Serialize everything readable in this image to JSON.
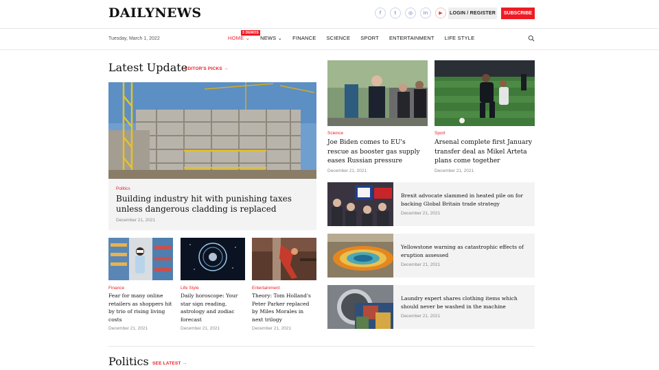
{
  "site": {
    "logo": "DAILYNEWS",
    "date": "Tuesday, March 1, 2022",
    "login_label": "LOGIN / REGISTER",
    "subscribe_label": "SUBSCRIBE",
    "accent_color": "#ee1b24"
  },
  "socials": [
    {
      "icon": "facebook-icon",
      "glyph": "f"
    },
    {
      "icon": "twitter-icon",
      "glyph": "t"
    },
    {
      "icon": "instagram-icon",
      "glyph": "◎"
    },
    {
      "icon": "linkedin-icon",
      "glyph": "in"
    },
    {
      "icon": "youtube-icon",
      "glyph": "▶"
    }
  ],
  "nav": {
    "items": [
      {
        "label": "HOME ⌄",
        "active": true
      },
      {
        "label": "NEWS ⌄"
      },
      {
        "label": "FINANCE"
      },
      {
        "label": "SCIENCE"
      },
      {
        "label": "SPORT"
      },
      {
        "label": "ENTERTAINMENT"
      },
      {
        "label": "LIFE STYLE"
      }
    ],
    "badge": "3 DEMOS"
  },
  "latest": {
    "title": "Latest Update",
    "link": "EDITOR'S PICKS →",
    "featured": {
      "category": "Politics",
      "title": "Building industry hit with punishing taxes unless dangerous cladding is replaced",
      "date": "December 21, 2021"
    },
    "cards": [
      {
        "category": "Finance",
        "title": "Fear for many online retailers as shoppers hit by trio of rising living costs",
        "date": "December 21, 2021"
      },
      {
        "category": "Life Style",
        "title": "Daily horoscope: Your star sign reading, astrology and zodiac forecast",
        "date": "December 21, 2021"
      },
      {
        "category": "Entertainment",
        "title": "Theory: Tom Holland's Peter Parker replaced by Miles Morales in next trilogy",
        "date": "December 21, 2021"
      }
    ],
    "right_cards": [
      {
        "category": "Science",
        "title": "Joe Biden comes to EU's rescue as booster gas supply eases Russian pressure",
        "date": "December 21, 2021"
      },
      {
        "category": "Sport",
        "title": "Arsenal complete first January transfer deal as Mikel Arteta plans come together",
        "date": "December 21, 2021"
      }
    ],
    "list": [
      {
        "title": "Brexit advocate slammed in heated pile on for backing Global Britain trade strategy",
        "date": "December 21, 2021"
      },
      {
        "title": "Yellowstone warning as catastrophic effects of eruption assessed",
        "date": "December 21, 2021"
      },
      {
        "title": "Laundry expert shares clothing items which should never be washed in the machine",
        "date": "December 21, 2021"
      }
    ]
  },
  "politics": {
    "title": "Politics",
    "link": "SEE LATEST →"
  }
}
